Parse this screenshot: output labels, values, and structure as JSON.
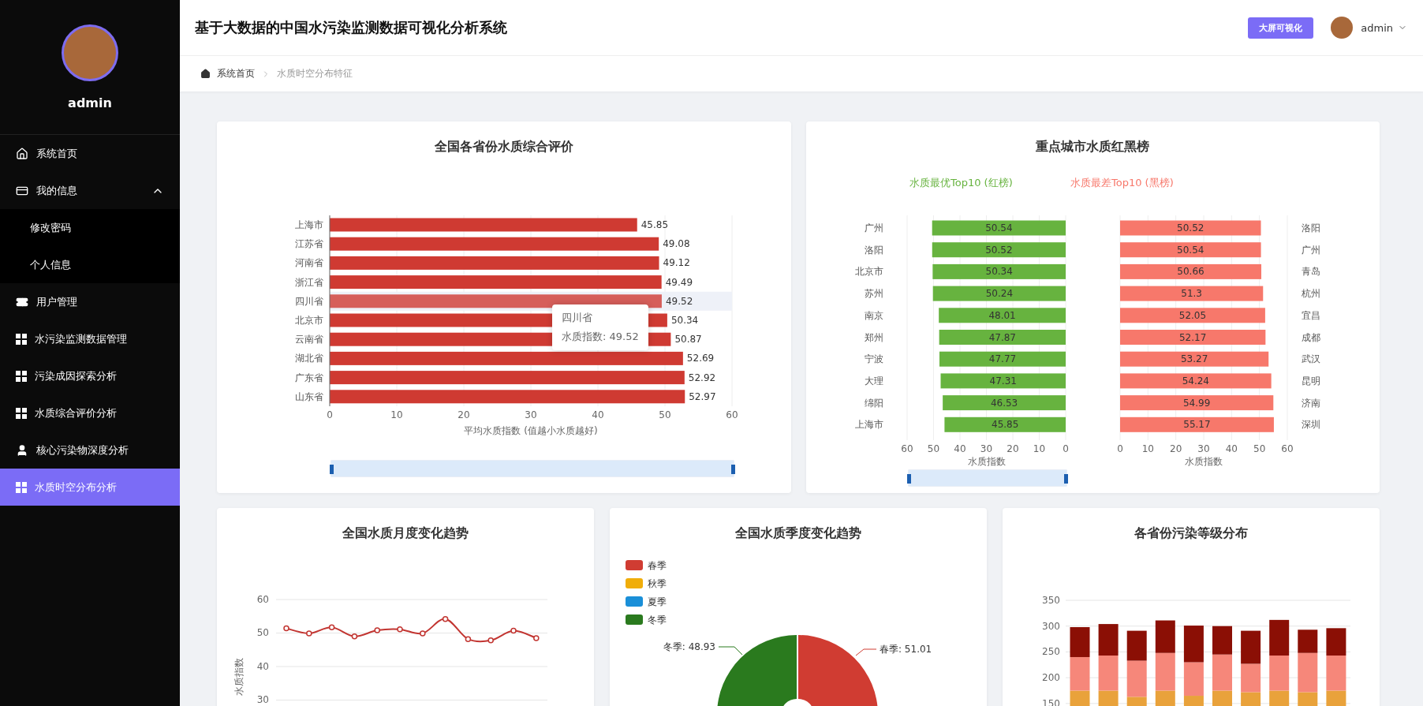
{
  "sidebar": {
    "user": {
      "name": "admin"
    },
    "menu": [
      {
        "label": "系统首页",
        "kind": "home",
        "selected": false
      },
      {
        "label": "我的信息",
        "kind": "card",
        "selected": false,
        "expanded": true,
        "children": [
          {
            "label": "修改密码",
            "selected": false
          },
          {
            "label": "个人信息",
            "selected": false
          }
        ]
      },
      {
        "label": "用户管理",
        "kind": "ticket",
        "selected": false
      },
      {
        "label": "水污染监测数据管理",
        "kind": "grid",
        "selected": false
      },
      {
        "label": "污染成因探索分析",
        "kind": "grid",
        "selected": false
      },
      {
        "label": "水质综合评价分析",
        "kind": "grid",
        "selected": false
      },
      {
        "label": "核心污染物深度分析",
        "kind": "user",
        "selected": false
      },
      {
        "label": "水质时空分布分析",
        "kind": "grid",
        "selected": true
      }
    ]
  },
  "header": {
    "title": "基于大数据的中国水污染监测数据可视化分析系统",
    "screen_button": "大屏可视化",
    "user": "admin"
  },
  "breadcrumb": [
    "系统首页",
    "水质时空分布特征"
  ],
  "province_chart": {
    "title": "全国各省份水质综合评价",
    "chart_data": {
      "type": "bar",
      "orientation": "horizontal",
      "xlabel": "平均水质指数 (值越小水质越好)",
      "categories": [
        "上海市",
        "江苏省",
        "河南省",
        "浙江省",
        "四川省",
        "北京市",
        "云南省",
        "湖北省",
        "广东省",
        "山东省"
      ],
      "xlim": [
        0,
        60
      ],
      "xticks": [
        0,
        10,
        20,
        30,
        40,
        50,
        60
      ],
      "data_labels": true,
      "grid": true,
      "series": [
        {
          "color": "#cf3a32",
          "values": [
            45.85,
            49.08,
            49.12,
            49.49,
            49.52,
            50.34,
            50.87,
            52.69,
            52.92,
            52.97
          ]
        }
      ]
    },
    "tooltip": {
      "title": "四川省",
      "text": "水质指数: 49.52"
    },
    "slider": {
      "level": 1
    }
  },
  "city_ranking": {
    "title": "重点城市水质红黑榜",
    "best": {
      "chart_data": {
        "type": "bar",
        "orientation": "horizontal",
        "xlabel": "水质指数",
        "categories": [
          "广州",
          "洛阳",
          "北京市",
          "苏州",
          "南京",
          "郑州",
          "宁波",
          "大理",
          "绵阳",
          "上海市"
        ],
        "xlim": [
          60,
          0
        ],
        "xticks": [
          60,
          50,
          40,
          30,
          20,
          10,
          0
        ],
        "data_labels": true,
        "grid": true,
        "series": [
          {
            "name": "水质最优Top10 (红榜)",
            "color": "#67b33f",
            "values": [
              50.54,
              50.52,
              50.34,
              50.24,
              48.01,
              47.87,
              47.77,
              47.31,
              46.53,
              45.85
            ]
          }
        ]
      },
      "slider": {
        "level": 1
      }
    },
    "worst": {
      "chart_data": {
        "type": "bar",
        "orientation": "horizontal",
        "xlabel": "水质指数",
        "categories": [
          "洛阳",
          "广州",
          "青岛",
          "杭州",
          "宜昌",
          "成都",
          "武汉",
          "昆明",
          "济南",
          "深圳"
        ],
        "xlim": [
          0,
          60
        ],
        "xticks": [
          0,
          10,
          20,
          30,
          40,
          50,
          60
        ],
        "data_labels": true,
        "grid": true,
        "series": [
          {
            "name": "水质最差Top10 (黑榜)",
            "color": "#f7786b",
            "values": [
              50.52,
              50.54,
              50.66,
              51.3,
              52.05,
              52.17,
              53.27,
              54.24,
              54.99,
              55.17
            ]
          }
        ]
      }
    }
  },
  "monthly_trend": {
    "title": "全国水质月度变化趋势",
    "chart_data": {
      "type": "line",
      "ylabel": "水质指数",
      "ylim": [
        30,
        60
      ],
      "yticks": [
        30,
        40,
        50,
        60
      ],
      "grid": true,
      "series": [
        {
          "color": "#c23531",
          "marker": true,
          "values": [
            51.4,
            49.9,
            51.7,
            49.0,
            50.8,
            51.1,
            49.9,
            54.2,
            48.2,
            47.8,
            50.7,
            48.5
          ]
        }
      ]
    }
  },
  "seasonal_trend": {
    "title": "全国水质季度变化趋势",
    "legend": [
      {
        "label": "春季",
        "color": "#d03c32"
      },
      {
        "label": "秋季",
        "color": "#f0ad0a"
      },
      {
        "label": "夏季",
        "color": "#1a8fd8"
      },
      {
        "label": "冬季",
        "color": "#2a7a1e"
      }
    ],
    "slices": [
      {
        "kind": "left",
        "label": "冬季: 48.93",
        "color": "#2a7a1e"
      },
      {
        "kind": "right",
        "label": "春季: 51.01",
        "color": "#d03c32"
      }
    ]
  },
  "pollution_levels": {
    "title": "各省份污染等级分布",
    "chart_data": {
      "type": "bar",
      "stacked": true,
      "ylim": [
        0,
        350
      ],
      "yticks": [
        150,
        200,
        250,
        300,
        350
      ],
      "grid": true,
      "series": [
        {
          "color": "#e9a23b",
          "values": [
            175,
            175,
            163,
            175,
            165,
            175,
            172,
            175,
            172,
            175
          ]
        },
        {
          "color": "#f6877a",
          "values": [
            65,
            68,
            70,
            73,
            65,
            70,
            55,
            68,
            76,
            68
          ]
        },
        {
          "color": "#8b0f05",
          "values": [
            58,
            61,
            58,
            63,
            71,
            55,
            64,
            69,
            45,
            53
          ]
        }
      ]
    }
  }
}
